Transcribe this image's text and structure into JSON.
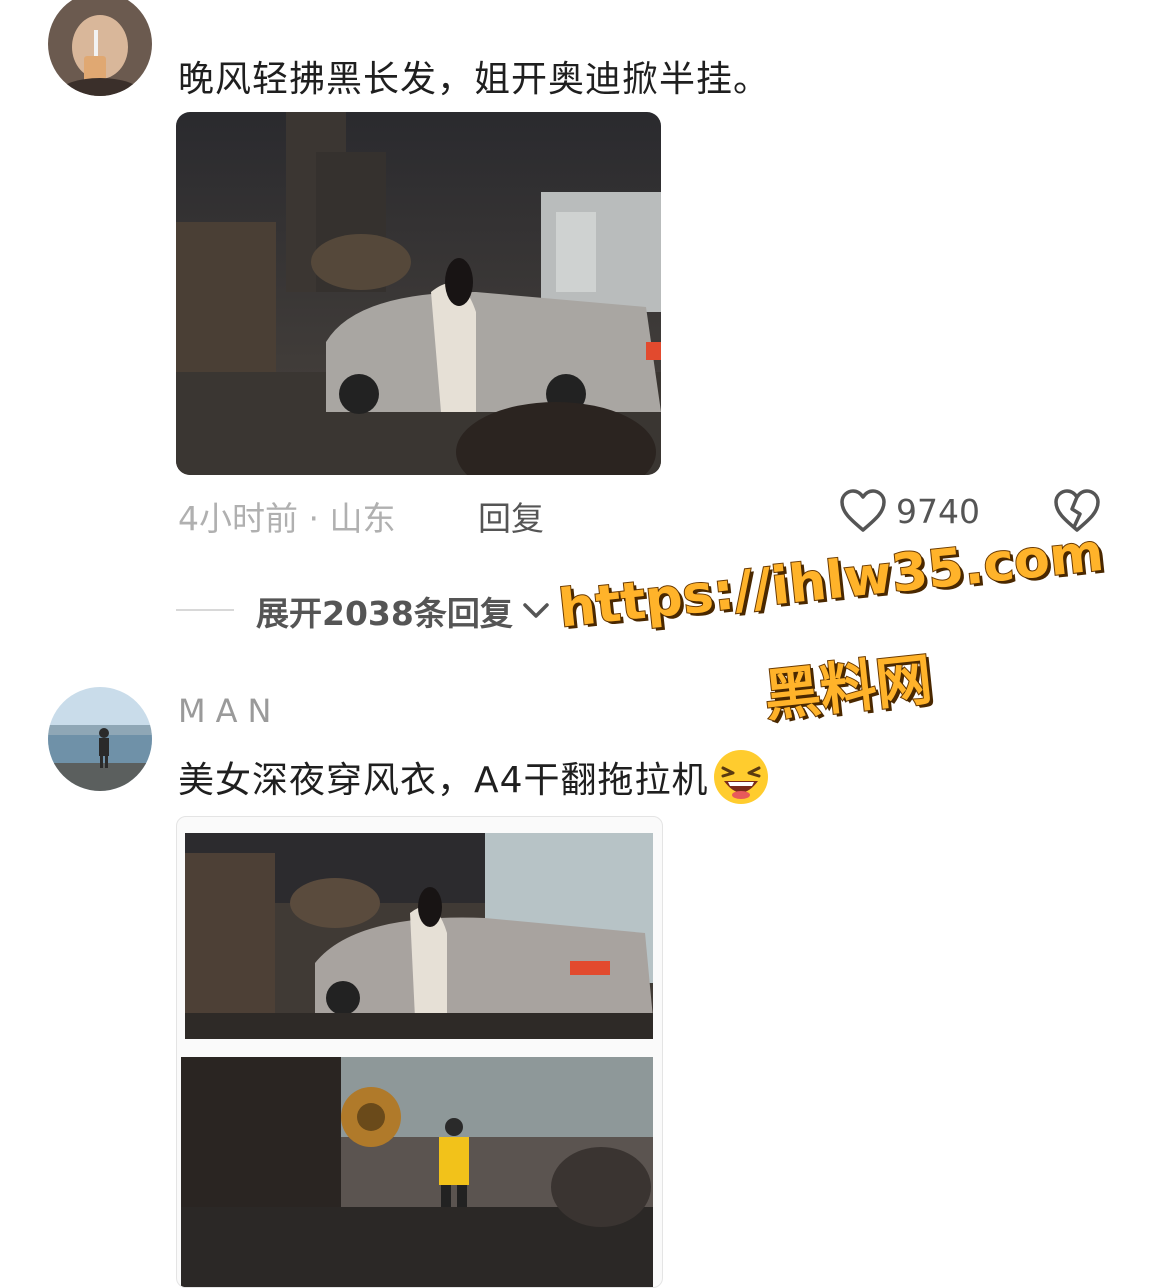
{
  "comment1": {
    "text": "晚风轻拂黑长发，姐开奥迪掀半挂。",
    "time_location": "4小时前 · 山东",
    "reply_label": "回复",
    "likes": "9740"
  },
  "expand": {
    "label": "展开2038条回复"
  },
  "comment2": {
    "username": "MAN",
    "text": "美女深夜穿风衣，A4干翻拖拉机"
  },
  "watermark": {
    "url": "https://ihlw35.com",
    "name": "黑料网"
  },
  "colors": {
    "watermark": "#ffb32a",
    "meta": "#b0b0b0"
  }
}
